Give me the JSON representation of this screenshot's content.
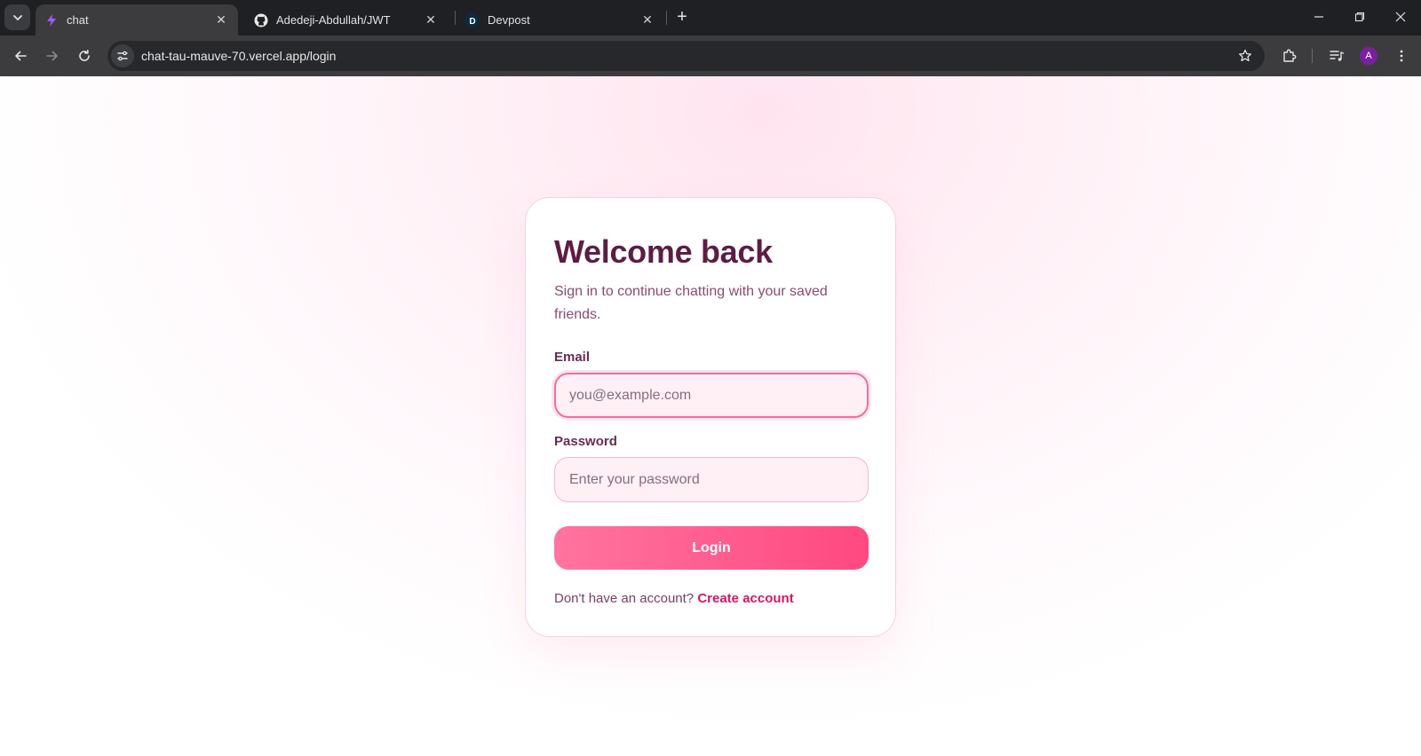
{
  "browser": {
    "tabs": [
      {
        "title": "chat",
        "icon": "bolt-icon",
        "active": true
      },
      {
        "title": "Adedeji-Abdullah/JWT",
        "icon": "github-icon",
        "active": false
      },
      {
        "title": "Devpost",
        "icon": "devpost-icon",
        "active": false
      }
    ],
    "url": "chat-tau-mauve-70.vercel.app/login",
    "profile_initial": "A",
    "devpost_letter": "D"
  },
  "login": {
    "title": "Welcome back",
    "subtitle": "Sign in to continue chatting with your saved friends.",
    "email_label": "Email",
    "email_placeholder": "you@example.com",
    "email_value": "",
    "password_label": "Password",
    "password_placeholder": "Enter your password",
    "password_value": "",
    "login_button": "Login",
    "footer_prompt": "Don't have an account?",
    "footer_link": "Create account"
  },
  "colors": {
    "accent": "#ff4880",
    "title": "#5c1d45",
    "link": "#d11866"
  }
}
